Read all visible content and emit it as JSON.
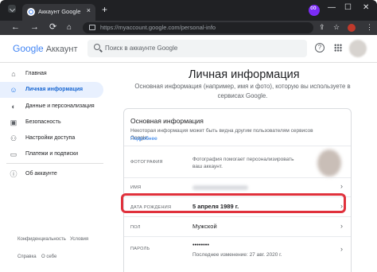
{
  "browser": {
    "tab_title": "Аккаунт Google",
    "tab_close": "×",
    "new_tab": "+",
    "minimize": "—",
    "maximize": "☐",
    "close": "✕",
    "back": "←",
    "forward": "→",
    "reload": "⟳",
    "url": "https://myaccount.google.com/personal-info"
  },
  "header": {
    "logo_google": "Google",
    "logo_account": "Аккаунт",
    "search_placeholder": "Поиск в аккаунте Google",
    "help_icon": "?"
  },
  "sidebar": {
    "items": [
      {
        "label": "Главная",
        "icon": "home-icon",
        "glyph": "⌂"
      },
      {
        "label": "Личная информация",
        "icon": "person-icon",
        "glyph": "☺"
      },
      {
        "label": "Данные и персонализация",
        "icon": "toggle-icon",
        "glyph": "◐"
      },
      {
        "label": "Безопасность",
        "icon": "lock-icon",
        "glyph": "▣"
      },
      {
        "label": "Настройки доступа",
        "icon": "people-icon",
        "glyph": "⚇"
      },
      {
        "label": "Платежи и подписки",
        "icon": "card-icon",
        "glyph": "▭"
      },
      {
        "label": "Об аккаунте",
        "icon": "info-icon",
        "glyph": "ⓘ"
      }
    ],
    "footer": {
      "privacy": "Конфиденциальность",
      "terms": "Условия",
      "help": "Справка",
      "about": "О себе"
    }
  },
  "main": {
    "title": "Личная информация",
    "description": "Основная информация (например, имя и фото), которую вы используете в сервисах Google.",
    "card": {
      "title": "Основная информация",
      "description": "Некоторая информация может быть видна другим пользователям сервисов Google.",
      "link": "Подробнее",
      "rows": [
        {
          "label": "Фотография",
          "value": "Фотография помогает персонализировать ваш аккаунт."
        },
        {
          "label": "Имя",
          "value": ""
        },
        {
          "label": "Дата рождения",
          "value": "5 апреля 1989 г."
        },
        {
          "label": "Пол",
          "value": "Мужской"
        },
        {
          "label": "Пароль",
          "value": "••••••••",
          "sub": "Последнее изменение: 27 авг. 2020 г."
        }
      ],
      "chevron": "›"
    }
  },
  "colors": {
    "accent": "#1a73e8",
    "highlight": "#e0313c",
    "chrome_dark": "#202124"
  }
}
